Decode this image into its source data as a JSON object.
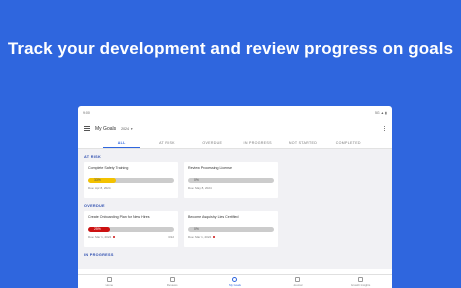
{
  "headline": "Track your development and review progress on goals",
  "status": {
    "time": "9:00",
    "right": "5G ▲ ▮"
  },
  "appbar": {
    "title": "My Goals",
    "year": "2024"
  },
  "tabs": [
    {
      "label": "ALL",
      "active": true
    },
    {
      "label": "AT RISK"
    },
    {
      "label": "OVERDUE"
    },
    {
      "label": "IN PROGRESS"
    },
    {
      "label": "NOT STARTED"
    },
    {
      "label": "COMPLETED"
    }
  ],
  "sections": {
    "at_risk": {
      "label": "AT RISK",
      "cards": [
        {
          "name": "Complete Safety Training",
          "percent_label": "33%",
          "progress": 0.33,
          "color": "#f3c200",
          "due": "Due: Apr 8, 2024"
        },
        {
          "name": "Review Processing License",
          "percent_label": "0%",
          "progress": 0,
          "color": "#cccccc",
          "due": "Due: May 8, 2024"
        }
      ]
    },
    "overdue": {
      "label": "OVERDUE",
      "cards": [
        {
          "name": "Create Onboarding Plan for New Hires",
          "percent_label": "25%",
          "progress": 0.25,
          "color": "#cc1111",
          "due": "Due: Mar 1, 2024",
          "corner": "3/12"
        },
        {
          "name": "Become Asquishy Lies Certified",
          "percent_label": "0%",
          "progress": 0,
          "color": "#cccccc",
          "due": "Due: Mar 1, 2024"
        }
      ]
    },
    "in_progress": {
      "label": "IN PROGRESS"
    }
  },
  "bottom_nav": [
    {
      "label": "Home",
      "icon": "home-icon"
    },
    {
      "label": "Reviews",
      "icon": "reviews-icon"
    },
    {
      "label": "My Goals",
      "icon": "goals-icon",
      "active": true
    },
    {
      "label": "Journal",
      "icon": "journal-icon"
    },
    {
      "label": "Growth Insights",
      "icon": "insights-icon"
    }
  ],
  "colors": {
    "brand": "#2f66de",
    "overdue": "#cc1111",
    "at_risk": "#f3c200"
  }
}
